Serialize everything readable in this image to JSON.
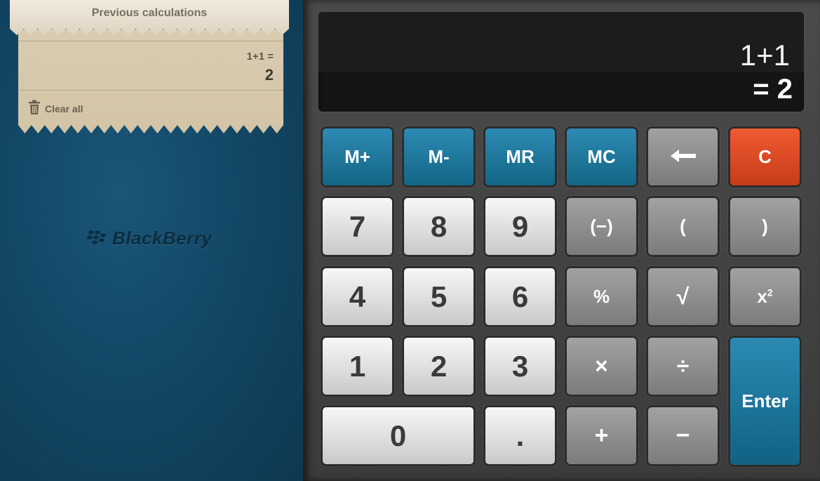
{
  "history": {
    "title": "Previous calculations",
    "entries": [
      {
        "expression": "1+1 =",
        "result": "2"
      }
    ],
    "clear_label": "Clear all"
  },
  "brand": {
    "logo_text": "BlackBerry"
  },
  "display": {
    "expression": "1+1",
    "result": "= 2"
  },
  "keys": {
    "m_plus": "M+",
    "m_minus": "M-",
    "mr": "MR",
    "mc": "MC",
    "clear": "C",
    "seven": "7",
    "eight": "8",
    "nine": "9",
    "negate": "(−)",
    "open_paren": "(",
    "close_paren": ")",
    "four": "4",
    "five": "5",
    "six": "6",
    "percent": "%",
    "sqrt": "√",
    "square_base": "x",
    "square_exp": "2",
    "one": "1",
    "two": "2",
    "three": "3",
    "multiply": "×",
    "divide": "÷",
    "enter": "Enter",
    "zero": "0",
    "decimal": ".",
    "plus": "+",
    "minus": "−"
  },
  "icons": {
    "backspace": "left-arrow-icon",
    "clear_all": "trash-icon",
    "logo": "blackberry-logo-icon"
  },
  "colors": {
    "memory_key": "#1b7399",
    "clear_key": "#dd4a22",
    "enter_key": "#1b7399",
    "left_panel": "#134766"
  }
}
